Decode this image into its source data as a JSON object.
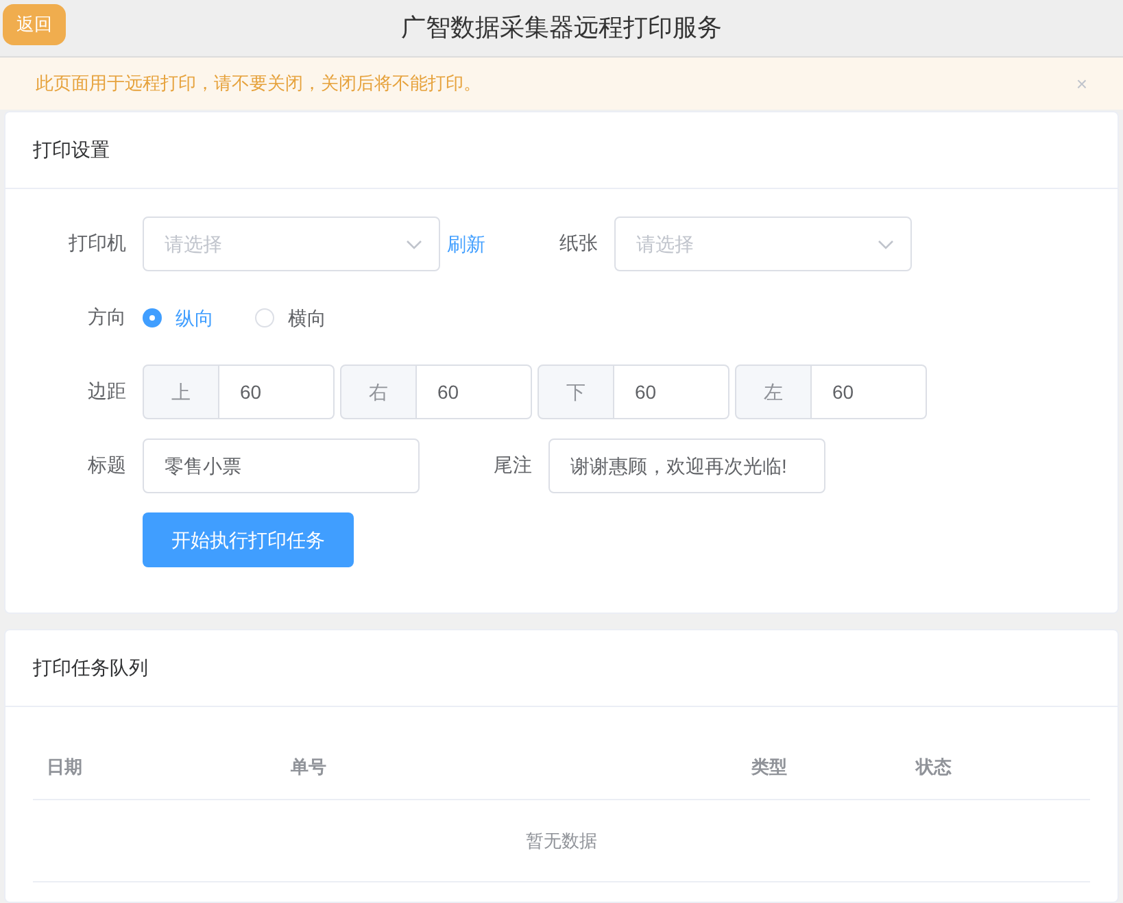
{
  "header": {
    "back_button": "返回",
    "title": "广智数据采集器远程打印服务"
  },
  "alert": {
    "text": "此页面用于远程打印，请不要关闭，关闭后将不能打印。",
    "close": "×"
  },
  "settings": {
    "title": "打印设置",
    "printer": {
      "label": "打印机",
      "placeholder": "请选择",
      "refresh": "刷新"
    },
    "paper": {
      "label": "纸张",
      "placeholder": "请选择"
    },
    "orientation": {
      "label": "方向",
      "options": [
        {
          "label": "纵向",
          "selected": true
        },
        {
          "label": "横向",
          "selected": false
        }
      ]
    },
    "margins": {
      "label": "边距",
      "items": [
        {
          "label": "上",
          "value": "60"
        },
        {
          "label": "右",
          "value": "60"
        },
        {
          "label": "下",
          "value": "60"
        },
        {
          "label": "左",
          "value": "60"
        }
      ]
    },
    "title_field": {
      "label": "标题",
      "value": "零售小票"
    },
    "footer_field": {
      "label": "尾注",
      "value": "谢谢惠顾，欢迎再次光临!"
    },
    "start_button": "开始执行打印任务"
  },
  "queue": {
    "title": "打印任务队列",
    "columns": [
      "日期",
      "单号",
      "类型",
      "状态"
    ],
    "empty_text": "暂无数据"
  }
}
